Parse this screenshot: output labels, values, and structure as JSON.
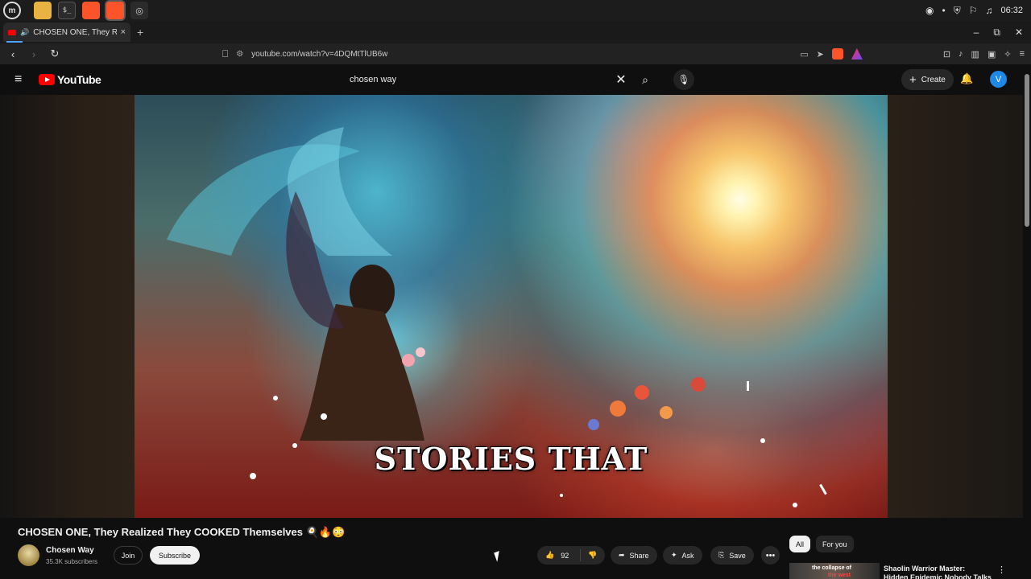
{
  "os_panel": {
    "clock": "06:32"
  },
  "browser": {
    "tab_title": "CHOSEN ONE, They Realize",
    "tab_close": "×",
    "new_tab": "+",
    "url": "youtube.com/watch?v=4DQMtTlUB6w",
    "window_controls": {
      "minimize": "–",
      "maximize": "⧉",
      "close": "✕"
    }
  },
  "youtube": {
    "logo_text": "YouTube",
    "search_value": "chosen way",
    "create_label": "Create",
    "avatar_letter": "V"
  },
  "video": {
    "caption": "STORIES THAT",
    "title": "CHOSEN ONE, They Realized They COOKED Themselves 🍳🔥😳"
  },
  "channel": {
    "name": "Chosen Way",
    "subscribers": "35.3K subscribers",
    "join_label": "Join",
    "subscribe_label": "Subscribe"
  },
  "actions": {
    "like_count": "92",
    "share_label": "Share",
    "ask_label": "Ask",
    "save_label": "Save",
    "more_label": "•••"
  },
  "sidebar": {
    "chips": [
      "All",
      "For you"
    ],
    "rec_thumb_text_1": "the collapse of",
    "rec_thumb_text_2": "the west",
    "rec_title": "Shaolin Warrior Master: Hidden Epidemic Nobody Talks About!"
  },
  "colors": {
    "yt_red": "#ff0000",
    "bg": "#0f0f0f",
    "accent_blue": "#1e88e5"
  }
}
